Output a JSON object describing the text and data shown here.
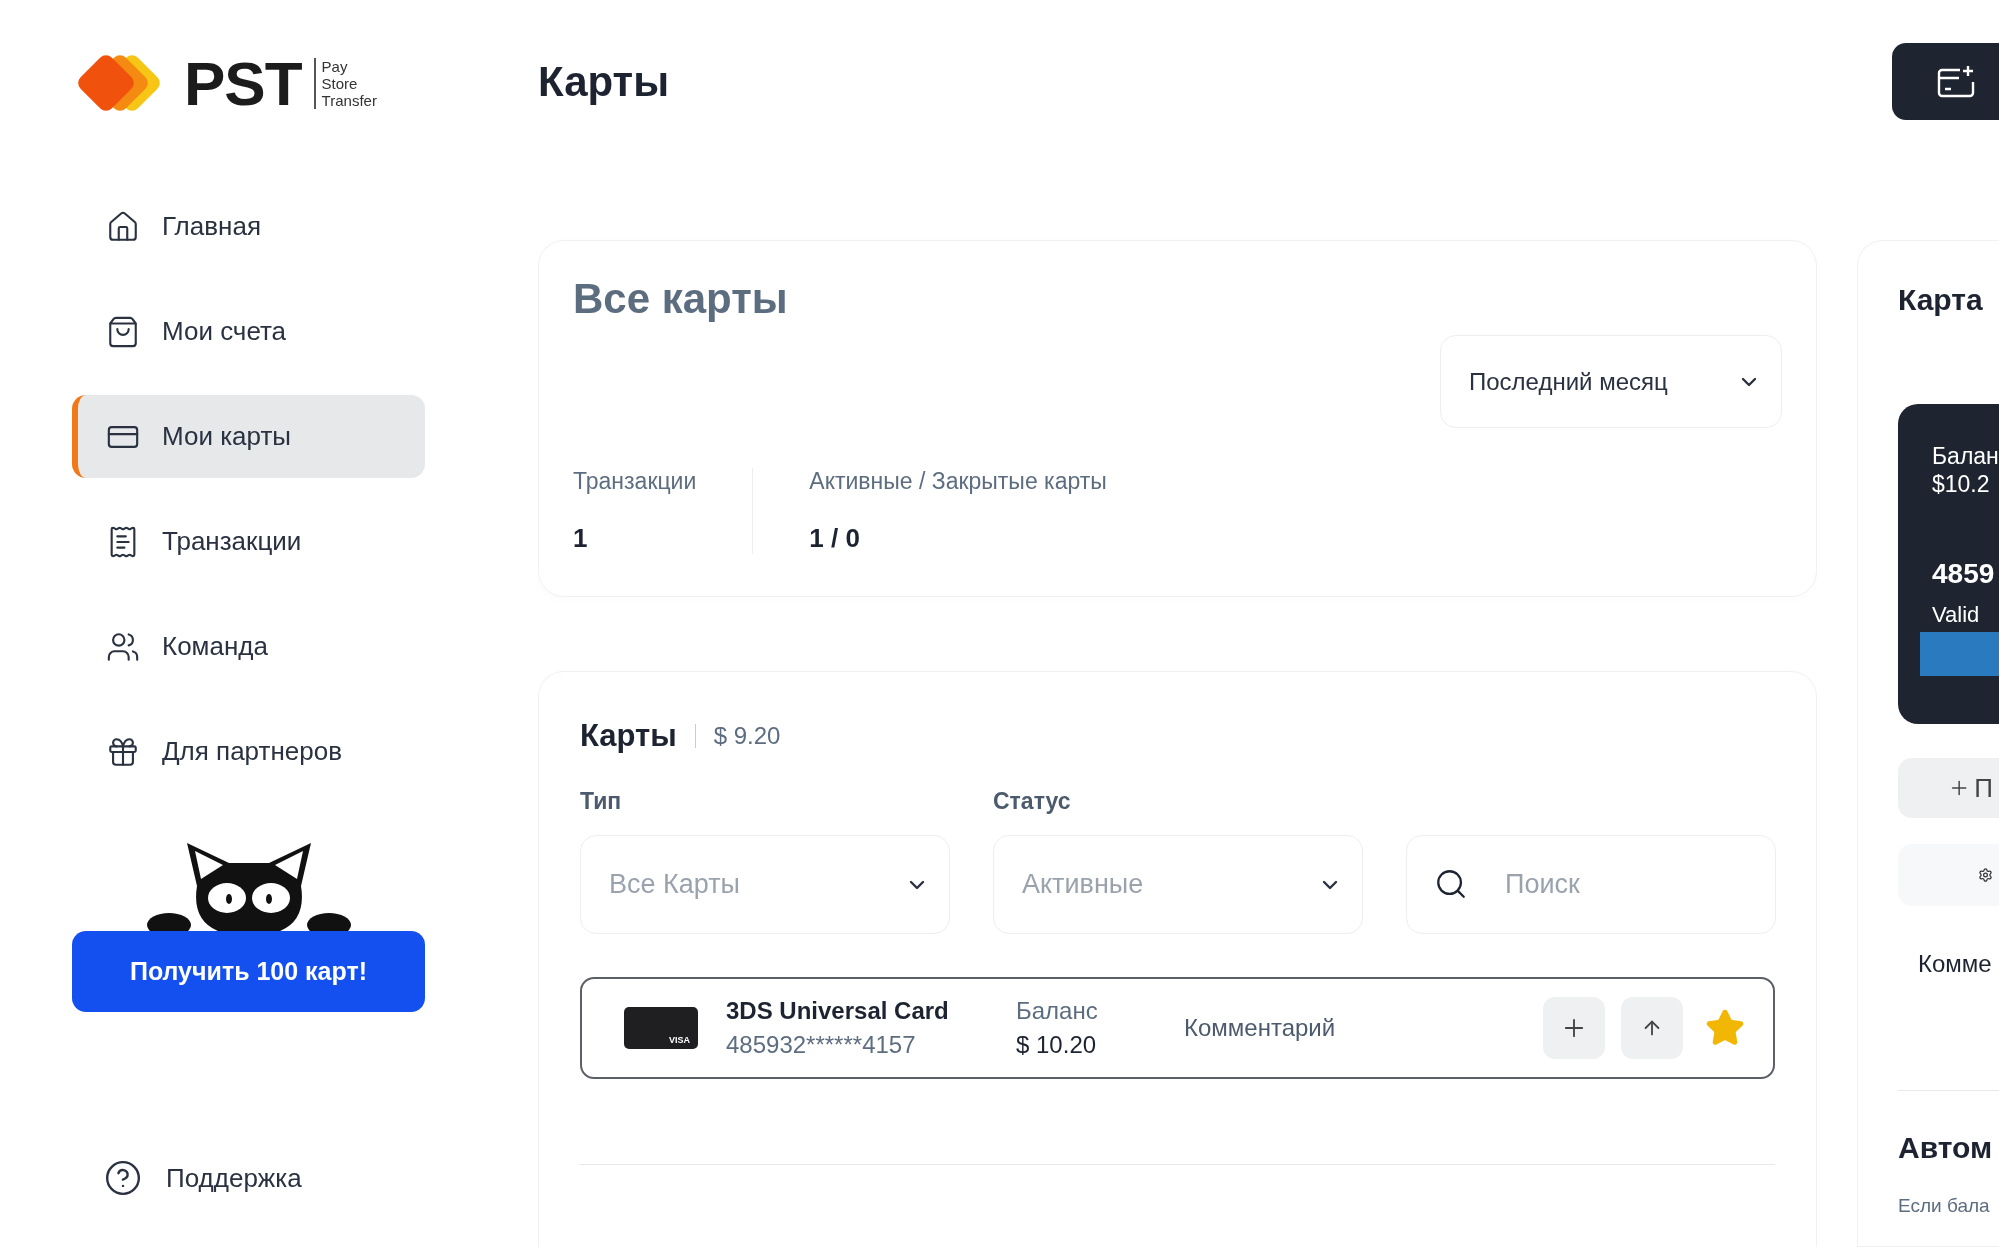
{
  "logo": {
    "name": "PST",
    "tagline": [
      "Pay",
      "Store",
      "Transfer"
    ]
  },
  "page_title": "Карты",
  "sidebar": {
    "items": [
      {
        "label": "Главная",
        "selected": false
      },
      {
        "label": "Мои счета",
        "selected": false
      },
      {
        "label": "Мои карты",
        "selected": true
      },
      {
        "label": "Транзакции",
        "selected": false
      },
      {
        "label": "Команда",
        "selected": false
      },
      {
        "label": "Для партнеров",
        "selected": false
      }
    ],
    "promo_button": "Получить 100 карт!",
    "support": "Поддержка"
  },
  "summary": {
    "title": "Все карты",
    "period": "Последний месяц",
    "stats": [
      {
        "label": "Транзакции",
        "value": "1"
      },
      {
        "label": "Активные / Закрытые карты",
        "value": "1 / 0"
      }
    ]
  },
  "cards": {
    "title": "Карты",
    "total": "$ 9.20",
    "filters": [
      {
        "label": "Тип",
        "value": "Все Карты"
      },
      {
        "label": "Статус",
        "value": "Активные"
      }
    ],
    "search": {
      "placeholder": "Поиск"
    },
    "rows": [
      {
        "name": "3DS Universal Card",
        "number": "485932******4157",
        "brand": "VISA",
        "balance_label": "Баланс",
        "balance": "$ 10.20",
        "comment": "Комментарий",
        "favorite": true
      }
    ]
  },
  "card_panel": {
    "title": "Карта",
    "balance_label": "Балан",
    "balance": "$10.2",
    "number": "4859",
    "valid": "Valid",
    "add_button": "П",
    "comment": "Комме",
    "auto_title": "Автом",
    "auto_text": "Если бала"
  }
}
